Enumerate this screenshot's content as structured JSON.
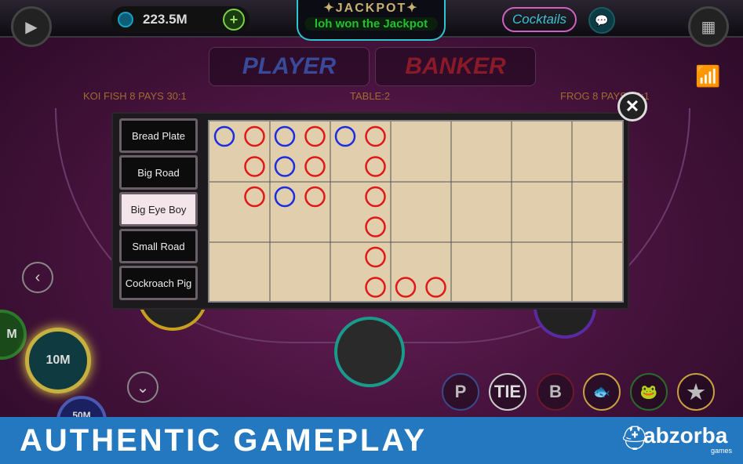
{
  "header": {
    "balance": "223.5M",
    "add_label": "+",
    "jackpot_title": "✦JACKPOT✦",
    "jackpot_message": "loh won the Jackpot",
    "cocktails_label": "Cocktails"
  },
  "bets": {
    "player": "PLAYER",
    "banker": "BANKER"
  },
  "table": {
    "left_info": "KOI FISH 8 PAYS 30:1",
    "center_info": "TABLE:2",
    "right_info": "FROG 8 PAYS 30:1"
  },
  "chips": {
    "selected": "10M",
    "left": "M",
    "below": "50M"
  },
  "bet_buttons": [
    "P",
    "TIE",
    "B",
    "Koi 8",
    "Frog 8",
    "★"
  ],
  "scoreboard": {
    "menu": [
      "Bread Plate",
      "Big Road",
      "Big Eye Boy",
      "Small Road",
      "Cockroach Pig"
    ],
    "active": "Big Eye Boy",
    "columns": [
      [
        "blue"
      ],
      [
        "red",
        "red",
        "red"
      ],
      [
        "blue",
        "blue",
        "blue"
      ],
      [
        "red",
        "red",
        "red"
      ],
      [
        "blue"
      ],
      [
        "red",
        "red",
        "red",
        "red",
        "red",
        "red"
      ],
      [
        null,
        null,
        null,
        null,
        null,
        "red"
      ],
      [
        null,
        null,
        null,
        null,
        null,
        "red"
      ]
    ],
    "colors": {
      "blue": "#1a2ee0",
      "red": "#e01818"
    }
  },
  "banner": {
    "title": "AUTHENTIC GAMEPLAY",
    "brand": "abzorba",
    "brand_sub": "games"
  },
  "colors": {
    "banner": "#2478c0",
    "board": "#e0ceac",
    "jackpot_border": "#2cc6d0"
  }
}
